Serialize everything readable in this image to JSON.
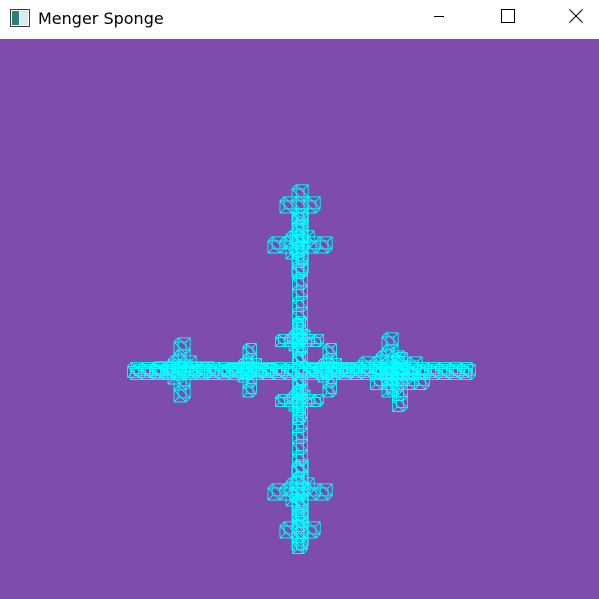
{
  "window": {
    "title": "Menger Sponge",
    "app_icon": "window-app-icon",
    "controls": [
      "minimize-icon",
      "maximize-icon",
      "close-icon"
    ]
  },
  "scene": {
    "background_color": "#7d4cad",
    "wireframe_color": "#00ffff",
    "render_mode": "wireframe"
  }
}
